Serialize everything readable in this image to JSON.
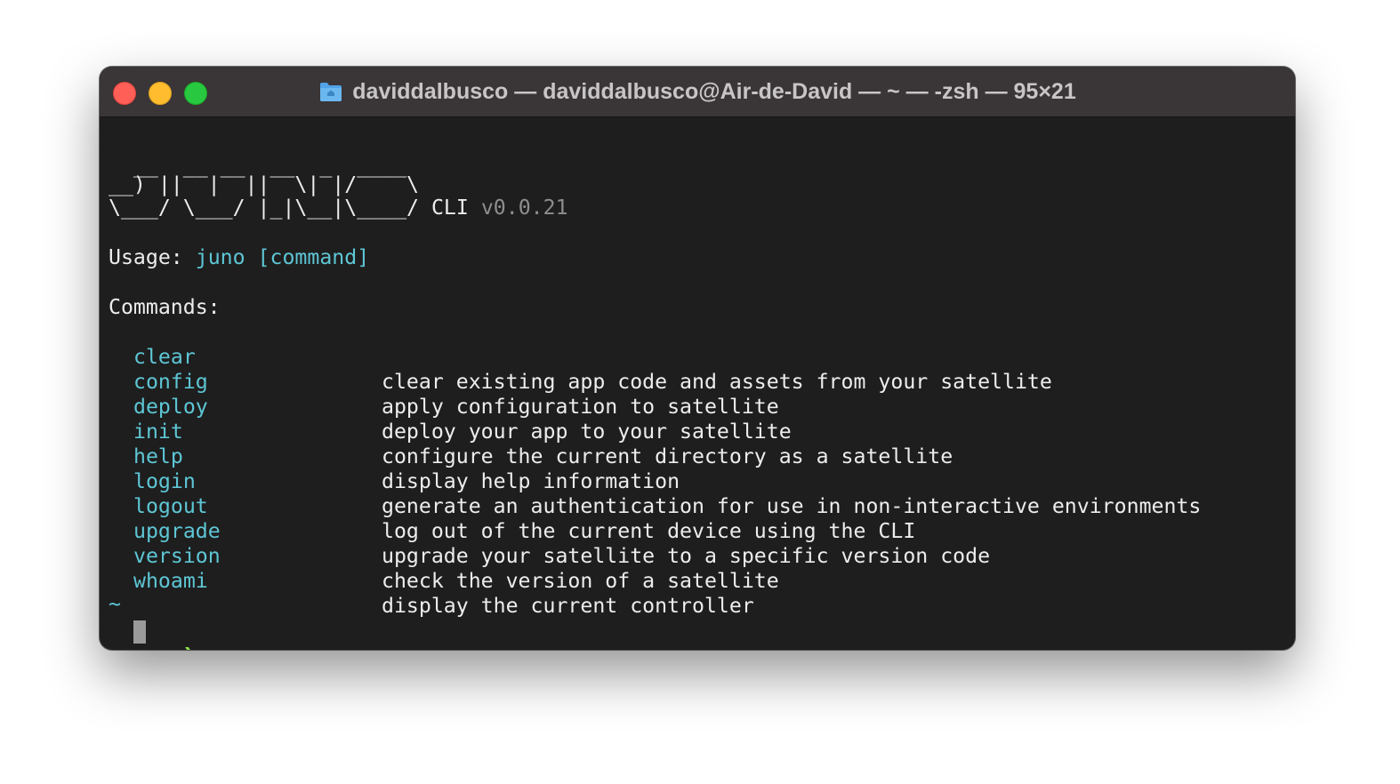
{
  "window": {
    "title": "daviddalbusco — daviddalbusco@Air-de-David — ~ — -zsh — 95×21",
    "icon": "folder-icon"
  },
  "banner": {
    "line1": "  __  __ __  __  _  ____",
    "line2": "__) ||  |  ||  \\| |/    \\",
    "line3_art": "\\___/ \\___/ |_|\\__|\\____/ ",
    "cli_label": "CLI",
    "version": "v0.0.21"
  },
  "usage": {
    "label": "Usage: ",
    "command": "juno [command]"
  },
  "commands_heading": "Commands:",
  "commands": [
    {
      "name": "clear",
      "description": "clear existing app code and assets from your satellite"
    },
    {
      "name": "config",
      "description": "apply configuration to satellite"
    },
    {
      "name": "deploy",
      "description": "deploy your app to your satellite"
    },
    {
      "name": "init",
      "description": "configure the current directory as a satellite"
    },
    {
      "name": "help",
      "description": "display help information"
    },
    {
      "name": "login",
      "description": "generate an authentication for use in non-interactive environments"
    },
    {
      "name": "logout",
      "description": "log out of the current device using the CLI"
    },
    {
      "name": "upgrade",
      "description": "upgrade your satellite to a specific version code"
    },
    {
      "name": "version",
      "description": "check the version of a satellite"
    },
    {
      "name": "whoami",
      "description": "display the current controller"
    }
  ],
  "prompt": {
    "cwd": "~",
    "symbol": "❯"
  },
  "colors": {
    "command_accent": "#5ec6d5",
    "prompt_accent": "#8fe04c",
    "background": "#1e1e1e"
  }
}
